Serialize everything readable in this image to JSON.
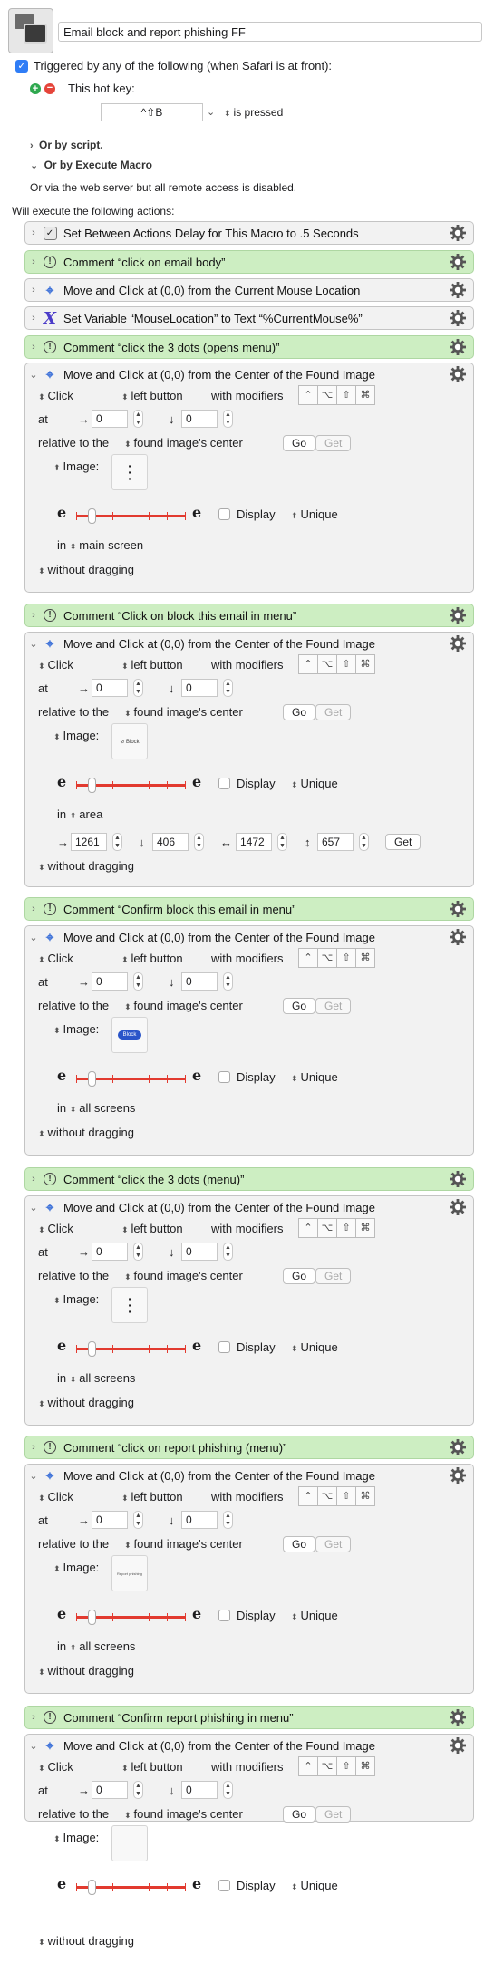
{
  "header": {
    "macro_name": "Email block and report phishing FF",
    "trigger_label": "Triggered by any of the following (when Safari is at front):",
    "hotkey_label": "This hot key:",
    "hotkey_value": "^⇧B",
    "hotkey_condition": "is pressed",
    "or_by_script": "Or by script.",
    "or_by_execute_macro": "Or by Execute Macro",
    "web_server_note": "Or via the web server but all remote access is disabled.",
    "will_execute": "Will execute the following actions:"
  },
  "common": {
    "click_mode": "Click",
    "mouse_button": "left button",
    "with_modifiers": "with modifiers",
    "at_label": "at",
    "relative_label": "relative to the",
    "relative_value": "found image's center",
    "go": "Go",
    "get": "Get",
    "image_label": "Image:",
    "display": "Display",
    "unique": "Unique",
    "in_label": "in",
    "without_dragging": "without dragging",
    "zero": "0",
    "modifier_keys": [
      "⌃",
      "⌥",
      "⇧",
      "⌘"
    ]
  },
  "actions": [
    {
      "type": "delay",
      "title": "Set Between Actions Delay for This Macro to .5 Seconds"
    },
    {
      "type": "comment",
      "title": "Comment “click on email body”"
    },
    {
      "type": "click-mouse",
      "title": "Move and Click at (0,0) from the Current Mouse Location"
    },
    {
      "type": "variable",
      "title": "Set Variable “MouseLocation” to Text “%CurrentMouse%”"
    },
    {
      "type": "comment",
      "title": "Comment “click the 3 dots (opens menu)”"
    },
    {
      "type": "click-image",
      "title": "Move and Click at (0,0) from the Center of the Found Image",
      "scope": "main screen",
      "image": "dots"
    },
    {
      "type": "comment",
      "title": "Comment “Click on block this email in menu”"
    },
    {
      "type": "click-image",
      "title": "Move and Click at (0,0) from the Center of the Found Image",
      "scope": "area",
      "image": "block-menu",
      "area": {
        "x": "1261",
        "y": "406",
        "w": "1472",
        "h": "657"
      }
    },
    {
      "type": "comment",
      "title": "Comment “Confirm block this email in menu”"
    },
    {
      "type": "click-image",
      "title": "Move and Click at (0,0) from the Center of the Found Image",
      "scope": "all screens",
      "image": "block-button"
    },
    {
      "type": "comment",
      "title": "Comment “click the 3 dots (menu)”"
    },
    {
      "type": "click-image",
      "title": "Move and Click at (0,0) from the Center of the Found Image",
      "scope": "all screens",
      "image": "dots"
    },
    {
      "type": "comment",
      "title": "Comment “click on report phishing (menu)”"
    },
    {
      "type": "click-image",
      "title": "Move and Click at (0,0) from the Center of the Found Image",
      "scope": "all screens",
      "image": "report"
    },
    {
      "type": "comment",
      "title": "Comment “Confirm report phishing in menu”"
    },
    {
      "type": "click-image",
      "title": "Move and Click at (0,0) from the Center of the Found Image",
      "scope": "",
      "image": "none"
    }
  ],
  "thumb_text": {
    "block_menu": "Block",
    "block_button": "Block",
    "report": "Report phishing"
  },
  "colors": {
    "comment_bg": "#cdeec2",
    "action_bg": "#f2f2f2",
    "slider": "#e23a2f",
    "checkbox": "#2f7df6"
  }
}
